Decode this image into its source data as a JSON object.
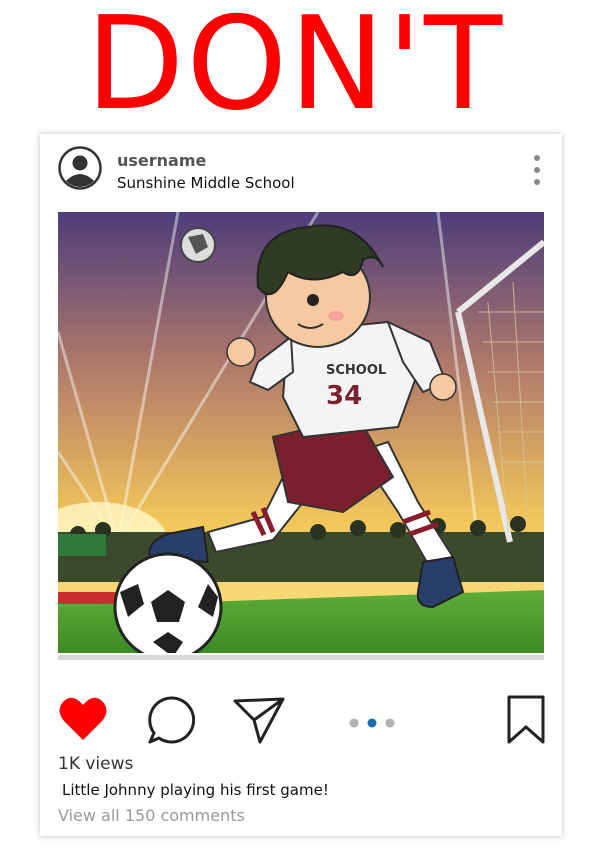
{
  "banner": {
    "text": "DON'T",
    "color": "#ff0000"
  },
  "post": {
    "username": "username",
    "location": "Sunshine Middle School",
    "image": {
      "jersey_text": "SCHOOL",
      "jersey_number": "34"
    },
    "carousel": {
      "count": 3,
      "active_index": 1
    },
    "views": "1K views",
    "caption": "Little Johnny playing his first game!",
    "comments_link": "View all 150 comments",
    "like_color": "#ff0000",
    "active_dot_color": "#1a6fb3"
  },
  "icons": [
    "avatar-icon",
    "more-options-icon",
    "heart-icon",
    "comment-icon",
    "share-icon",
    "bookmark-icon"
  ]
}
